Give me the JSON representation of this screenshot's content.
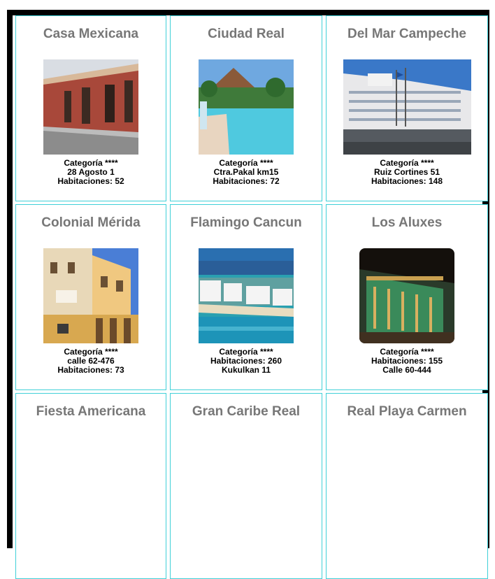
{
  "hotels": [
    {
      "name": "Casa Mexicana",
      "photo_icon": "colonial-street-photo",
      "lines": [
        "Categoría ****",
        "28 Agosto 1",
        "Habitaciones: 52"
      ]
    },
    {
      "name": "Ciudad Real",
      "photo_icon": "pool-photo",
      "lines": [
        "Categoría ****",
        "Ctra.Pakal km15",
        "Habitaciones: 72"
      ]
    },
    {
      "name": "Del Mar Campeche",
      "photo_icon": "hotel-facade-photo",
      "lines": [
        "Categoría ****",
        "Ruiz Cortines 51",
        "Habitaciones: 148"
      ]
    },
    {
      "name": "Colonial Mérida",
      "photo_icon": "colonial-building-photo",
      "lines": [
        "Categoría ****",
        "calle 62-476",
        "Habitaciones: 73"
      ]
    },
    {
      "name": "Flamingo Cancun",
      "photo_icon": "beach-resort-photo",
      "lines": [
        "Categoría ****",
        "Habitaciones: 260",
        "Kukulkan 11"
      ]
    },
    {
      "name": "Los Aluxes",
      "photo_icon": "night-hotel-photo",
      "lines": [
        "Categoría ****",
        "Habitaciones: 155",
        "Calle 60-444"
      ]
    },
    {
      "name": "Fiesta Americana",
      "lines": []
    },
    {
      "name": "Gran Caribe Real",
      "lines": []
    },
    {
      "name": "Real Playa Carmen",
      "lines": []
    }
  ],
  "colors": {
    "card_border": "#40d0d8",
    "title": "#777777",
    "frame": "#000000"
  }
}
